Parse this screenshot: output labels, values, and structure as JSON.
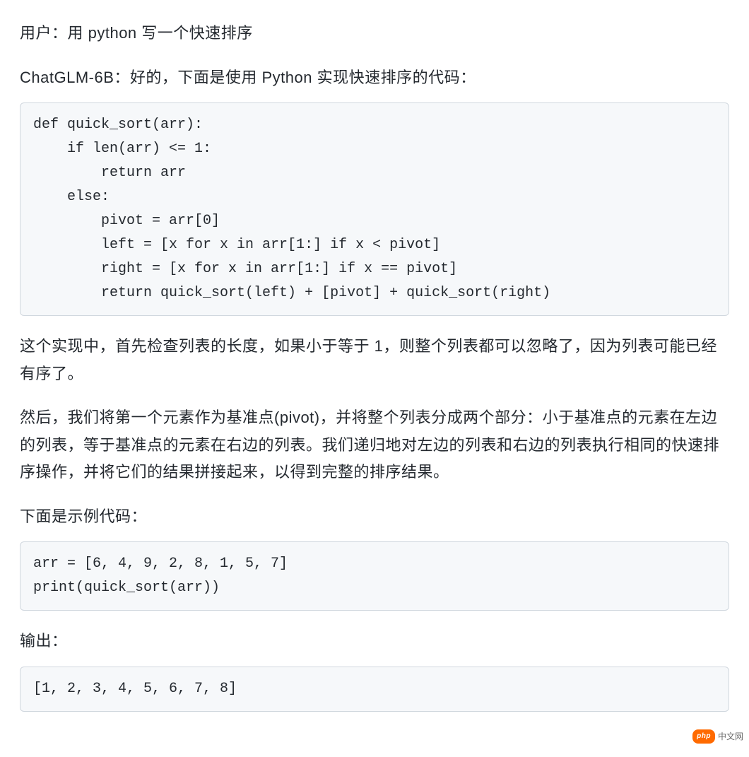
{
  "conversation": {
    "user_line": "用户：用 python 写一个快速排序",
    "bot_line": "ChatGLM-6B：好的，下面是使用 Python 实现快速排序的代码：",
    "code1": "def quick_sort(arr):\n    if len(arr) <= 1:\n        return arr\n    else:\n        pivot = arr[0]\n        left = [x for x in arr[1:] if x < pivot]\n        right = [x for x in arr[1:] if x == pivot]\n        return quick_sort(left) + [pivot] + quick_sort(right)",
    "explain1": "这个实现中，首先检查列表的长度，如果小于等于 1，则整个列表都可以忽略了，因为列表可能已经有序了。",
    "explain2": "然后，我们将第一个元素作为基准点(pivot)，并将整个列表分成两个部分：小于基准点的元素在左边的列表，等于基准点的元素在右边的列表。我们递归地对左边的列表和右边的列表执行相同的快速排序操作，并将它们的结果拼接起来，以得到完整的排序结果。",
    "example_label": "下面是示例代码：",
    "code2": "arr = [6, 4, 9, 2, 8, 1, 5, 7]\nprint(quick_sort(arr))",
    "output_label": "输出：",
    "code3": "[1, 2, 3, 4, 5, 6, 7, 8]"
  },
  "watermark": {
    "badge": "php",
    "text": "中文网"
  }
}
